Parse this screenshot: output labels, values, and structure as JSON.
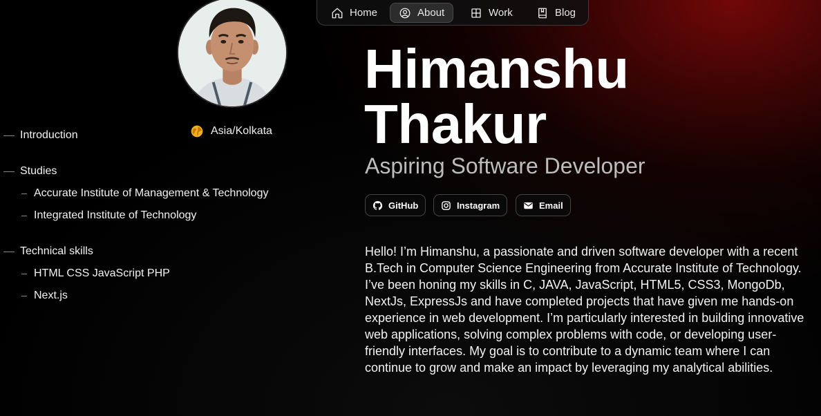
{
  "nav": {
    "items": [
      {
        "label": "Home",
        "icon": "home-icon"
      },
      {
        "label": "About",
        "icon": "user-circle-icon",
        "active": true
      },
      {
        "label": "Work",
        "icon": "grid-icon"
      },
      {
        "label": "Blog",
        "icon": "book-icon"
      }
    ]
  },
  "profile": {
    "avatar_alt": "profile-photo",
    "location": "Asia/Kolkata",
    "location_icon": "globe-icon"
  },
  "toc": {
    "introduction": "Introduction",
    "studies": "Studies",
    "studies_items": [
      "Accurate Institute of Management & Technology",
      "Integrated Institute of Technology"
    ],
    "skills": "Technical skills",
    "skills_items": [
      "HTML CSS JavaScript PHP",
      "Next.js"
    ]
  },
  "header": {
    "name_line1": "Himanshu",
    "name_line2": "Thakur",
    "role": "Aspiring Software Developer"
  },
  "social": {
    "github": "GitHub",
    "instagram": "Instagram",
    "email": "Email"
  },
  "bio": "Hello! I’m Himanshu, a passionate and driven software developer with a recent B.Tech in Computer Science Engineering from Accurate Institute of Technology. I’ve been honing my skills in C, JAVA, JavaScript, HTML5, CSS3, MongoDb, NextJs, ExpressJs and have completed projects that have given me hands-on experience in web development. I’m particularly interested in building innovative web applications, solving complex problems with code, or developing user-friendly interfaces. My goal is to contribute to a dynamic team where I can continue to grow and make an impact by leveraging my analytical abilities.",
  "colors": {
    "background": "#000000",
    "accent_glow": "#780808",
    "text": "#ffffff",
    "muted": "#bdbdbd"
  }
}
